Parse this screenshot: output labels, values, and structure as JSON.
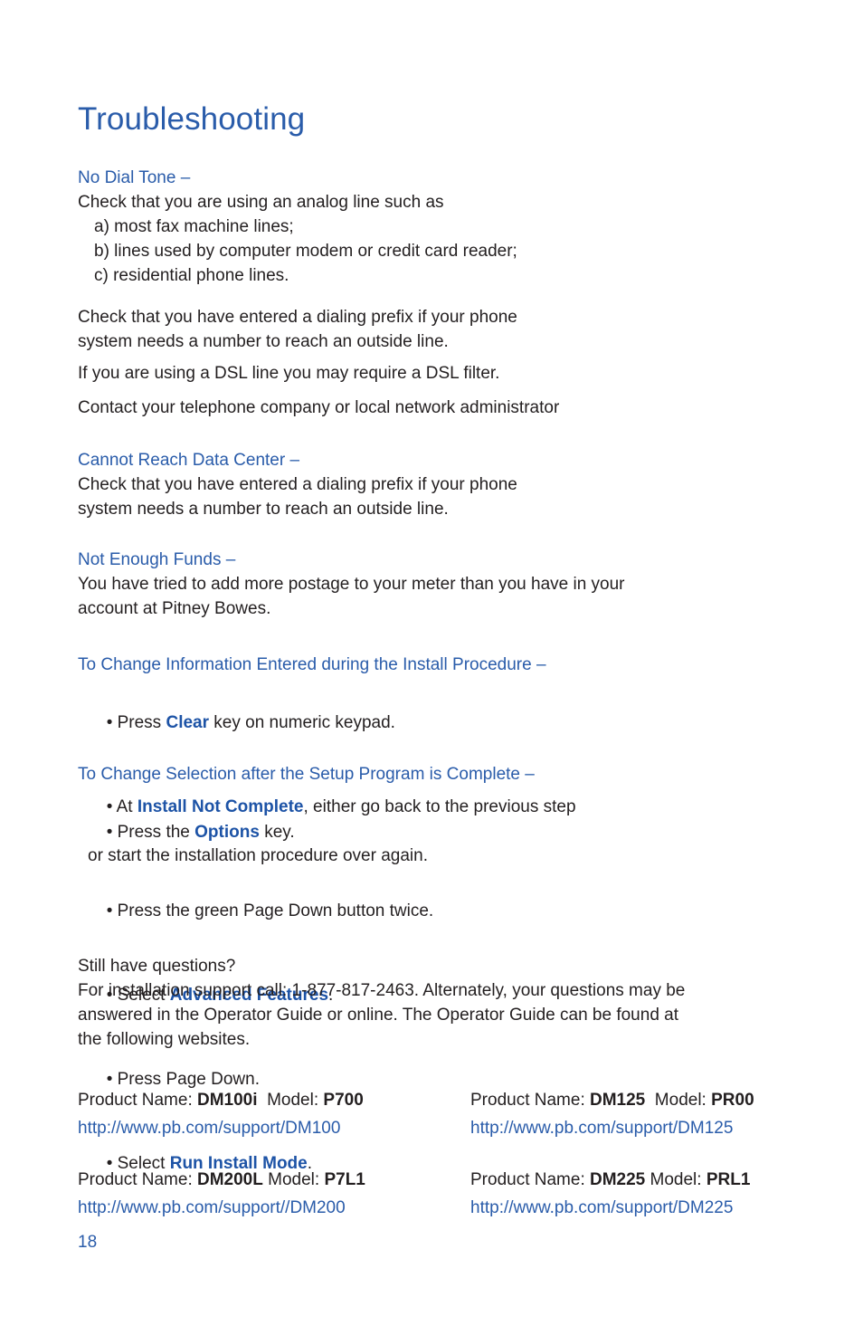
{
  "document": {
    "title": "Troubleshooting",
    "page_number": "18",
    "accent_color": "#2a5caa",
    "bold_inline_color": "#1d53a6",
    "body_color": "#231f20"
  },
  "sections": {
    "no_dial_tone": {
      "heading": "No Dial Tone –",
      "intro": "Check that you are using an analog line such as",
      "items": [
        "a) most fax machine lines;",
        "b) lines used by computer modem or credit card reader;",
        "c) residential phone lines."
      ],
      "check_prefix_line1": "Check that you have entered a dialing prefix if your phone",
      "check_prefix_line2": "system needs a number to reach an outside line.",
      "dsl": "If you are using a DSL line you may require a DSL filter.",
      "contact": "Contact your telephone company or local network administrator"
    },
    "cannot_reach_data_center": {
      "heading": "Cannot Reach Data Center –",
      "line1": "Check that you have entered a dialing prefix if your phone",
      "line2": "system needs a number to reach an outside line."
    },
    "not_enough_funds": {
      "heading": "Not Enough Funds –",
      "line1": "You have tried to add more postage to your meter than you have in your",
      "line2": "account at Pitney Bowes."
    },
    "change_install_info": {
      "heading": "To Change Information Entered during the Install Procedure –",
      "bullet1_pre": "• Press ",
      "bullet1_bold": "Clear",
      "bullet1_post": " key on numeric keypad.",
      "bullet2_pre": "• At ",
      "bullet2_bold": "Install Not Complete",
      "bullet2_post": ", either go back to the previous step",
      "bullet2_cont": "or start the installation procedure over again."
    },
    "change_selection": {
      "heading": "To Change Selection after the Setup Program is Complete –",
      "bullets": [
        {
          "pre": "• Press the ",
          "bold": "Options",
          "post": " key."
        },
        {
          "pre": "• Press the green Page Down button twice.",
          "bold": "",
          "post": ""
        },
        {
          "pre": "• Select ",
          "bold": "Advanced Features",
          "post": "."
        },
        {
          "pre": "• Press Page Down.",
          "bold": "",
          "post": ""
        },
        {
          "pre": "• Select ",
          "bold": "Run Install Mode",
          "post": "."
        }
      ]
    },
    "support": {
      "line1": "Still have questions?",
      "line2": "For installation support call: 1-877-817-2463. Alternately, your questions may be",
      "line3": "answered in the Operator Guide or online. The Operator Guide can be found at",
      "line4": "the following websites.",
      "phone": "1-877-817-2463"
    }
  },
  "products": [
    [
      {
        "name_label": "Product Name: ",
        "name_value": "DM100i",
        "model_label": "  Model: ",
        "model_value": "P700",
        "url": "http://www.pb.com/support/DM100"
      },
      {
        "name_label": "Product Name: ",
        "name_value": "DM125",
        "model_label": "  Model: ",
        "model_value": "PR00",
        "url": "http://www.pb.com/support/DM125"
      }
    ],
    [
      {
        "name_label": "Product Name: ",
        "name_value": "DM200L",
        "model_label": " Model: ",
        "model_value": "P7L1",
        "url": "http://www.pb.com/support//DM200"
      },
      {
        "name_label": "Product Name: ",
        "name_value": "DM225",
        "model_label": " Model: ",
        "model_value": "PRL1",
        "url": "http://www.pb.com/support/DM225"
      }
    ]
  ]
}
